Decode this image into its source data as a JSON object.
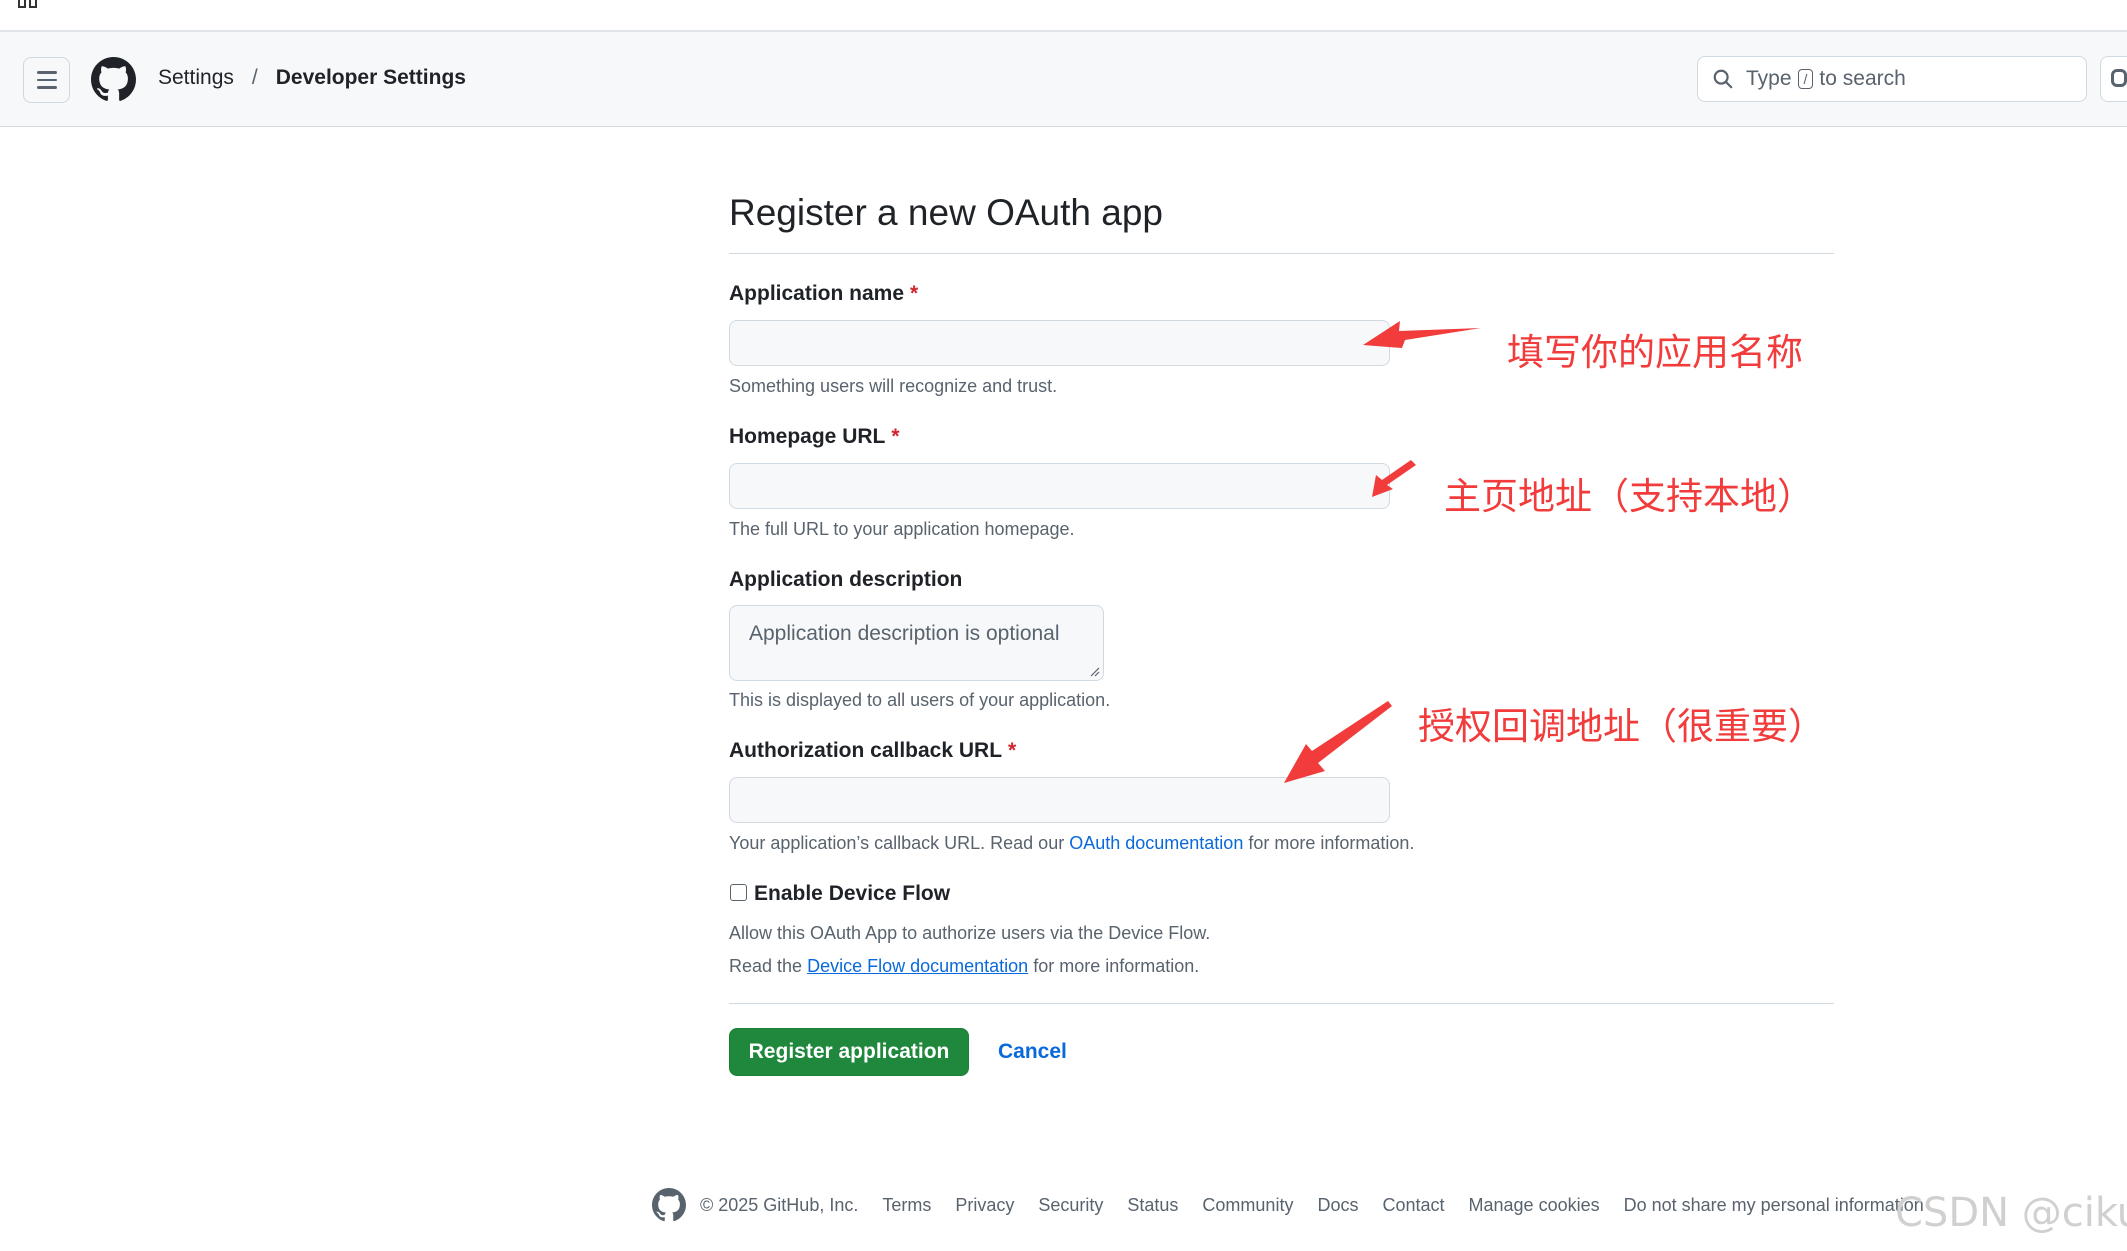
{
  "header": {
    "breadcrumb": {
      "settings": "Settings",
      "separator": "/",
      "current": "Developer Settings"
    },
    "search": {
      "prefix": "Type",
      "key": "/",
      "suffix": "to search"
    }
  },
  "form": {
    "title": "Register a new OAuth app",
    "required_mark": "*",
    "app_name": {
      "label": "Application name",
      "value": "",
      "hint": "Something users will recognize and trust."
    },
    "homepage": {
      "label": "Homepage URL",
      "value": "",
      "hint": "The full URL to your application homepage."
    },
    "description": {
      "label": "Application description",
      "placeholder": "Application description is optional",
      "hint": "This is displayed to all users of your application."
    },
    "callback": {
      "label": "Authorization callback URL",
      "value": "",
      "hint_before": "Your application’s callback URL. Read our",
      "hint_link": "OAuth documentation",
      "hint_after": "for more information."
    },
    "device_flow": {
      "label": "Enable Device Flow",
      "checked": false,
      "hint_line1": "Allow this OAuth App to authorize users via the Device Flow.",
      "hint_line2_before": "Read the",
      "hint_line2_link": "Device Flow documentation",
      "hint_line2_after": "for more information."
    },
    "register_button": "Register application",
    "cancel": "Cancel"
  },
  "annotations": {
    "app_name": "填写你的应用名称",
    "homepage": "主页地址（支持本地）",
    "callback": "授权回调地址（很重要）",
    "color": "#f23b3b"
  },
  "footer": {
    "copyright": "© 2025 GitHub, Inc.",
    "links": [
      "Terms",
      "Privacy",
      "Security",
      "Status",
      "Community",
      "Docs",
      "Contact",
      "Manage cookies",
      "Do not share my personal information"
    ]
  },
  "watermark": "CSDN @ciku",
  "colors": {
    "primary_button": "#1f883d",
    "link": "#0969da",
    "required": "#d1242f"
  }
}
